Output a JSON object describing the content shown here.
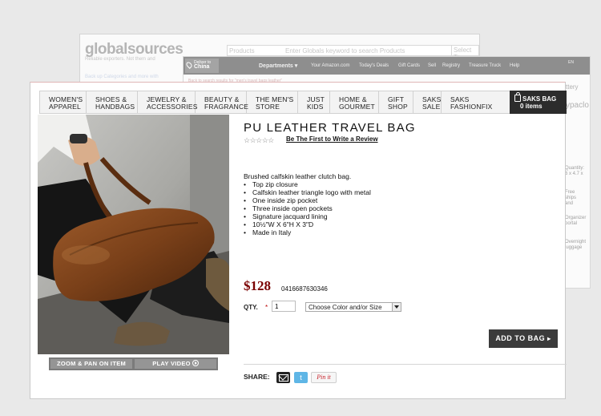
{
  "back_window": {
    "logo": "globalsources",
    "tagline": "Reliable exporters. Not them and",
    "search_category": "Products",
    "search_placeholder": "Enter Globals keyword to search Products",
    "search_button": "Select To",
    "subline": "Back up Categories and more with"
  },
  "middle_window": {
    "deliver_label": "Deliver to",
    "deliver_value": "China",
    "departments": "Departments ▾",
    "nav": [
      "Your Amazon.com",
      "Today's Deals",
      "Gift Cards",
      "Sell",
      "Registry",
      "Treasure Truck",
      "Help"
    ],
    "lang": "EN",
    "subline": "Back to search results for \"men's travel bags leather\"",
    "side_texts": [
      "Quantity:\n6 x 4.7 x",
      "Free\nships\nand",
      "Organizer\nportal",
      "Overnight\nluggage"
    ]
  },
  "far_right": {
    "snip1": "ypaclo",
    "snip2": "ttery"
  },
  "nav": {
    "items": [
      "WOMEN'S\nAPPAREL",
      "SHOES &\nHANDBAGS",
      "JEWELRY &\nACCESSORIES",
      "BEAUTY &\nFRAGRANCE",
      "THE MEN'S\nSTORE",
      "JUST\nKIDS",
      "HOME &\nGOURMET",
      "GIFT\nSHOP",
      "SAKS\nSALE",
      "SAKS\nFASHIONFIX"
    ],
    "bag_title": "SAKS BAG",
    "bag_count": "0 items"
  },
  "product": {
    "title": "PU LEATHER TRAVEL BAG",
    "stars": "☆☆☆☆☆",
    "review_link": "Be The First to Write a Review",
    "desc_intro": "Brushed calfskin leather clutch bag.",
    "features": [
      "Top zip closure",
      "Calfskin leather triangle logo with metal",
      "One inside zip pocket",
      "Three inside open pockets",
      "Signature jacquard lining",
      "10½\"W X 6\"H X 3\"D",
      "Made in Italy"
    ],
    "price": "$128",
    "sku": "0416687630346",
    "qty_label": "QTY.",
    "qty_required": "*",
    "qty_value": "1",
    "select_value": "Choose Color and/or Size",
    "add_button": "ADD TO BAG",
    "share_label": "SHARE:",
    "twitter_glyph": "t",
    "pinterest_label": "Pin it"
  },
  "photo_buttons": {
    "zoom": "ZOOM & PAN ON ITEM",
    "video": "PLAY VIDEO"
  },
  "colors": {
    "accent_price": "#7a0000",
    "bag_button": "#2c2c2c",
    "twitter": "#5fb6e6",
    "pinterest": "#c8232c"
  }
}
